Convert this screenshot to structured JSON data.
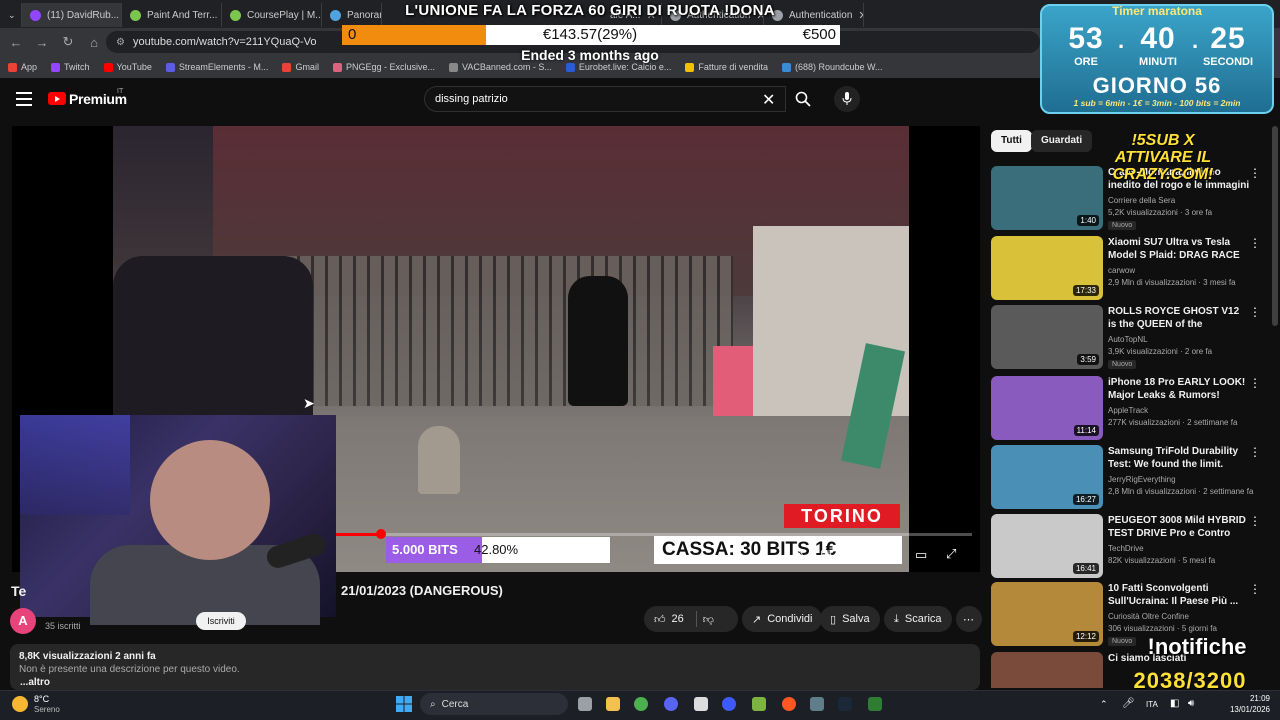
{
  "browser": {
    "tabs": [
      {
        "label": "(11) DavidRub..."
      },
      {
        "label": "Paint And Terr..."
      },
      {
        "label": "CoursePlay | M..."
      },
      {
        "label": "Panoramica"
      },
      {
        "label": "a Ri..."
      },
      {
        "label": "ntelli..."
      },
      {
        "label": "ale A..."
      },
      {
        "label": "Authentication"
      },
      {
        "label": "Authentication"
      }
    ],
    "url": "youtube.com/watch?v=211YQuaQ-Vo",
    "bookmarks": [
      "App",
      "Twitch",
      "YouTube",
      "StreamElements - M...",
      "Gmail",
      "PNGEgg - Exclusive...",
      "VACBanned.com - S...",
      "Eurobet.live: Calcio e...",
      "Fatture di vendita",
      "(688) Roundcube W..."
    ]
  },
  "stream_overlay": {
    "title": "L'UNIONE FA LA FORZA 60 GIRI DI RUOTA !DONA",
    "goal_start": "0",
    "goal_current": "€143.57(29%)",
    "goal_target": "€500",
    "goal_progress": 0.29,
    "ended_text": "Ended 3 months ago"
  },
  "timer": {
    "title": "Timer maratona",
    "hours": "53",
    "minutes": "40",
    "seconds": "25",
    "hours_label": "ORE",
    "minutes_label": "MINUTI",
    "seconds_label": "SECONDI",
    "day": "GIORNO 56",
    "rates": "1 sub = 6min - 1€ = 3min - 100 bits = 2min"
  },
  "promo": {
    "sub_line1": "!5SUB X",
    "sub_line2": "ATTIVARE IL",
    "sub_line3": "CRAZY.COM!",
    "notifiche": "!notifiche",
    "notifiche_count": "2038/3200"
  },
  "youtube": {
    "logo_text": "Premium",
    "region": "IT",
    "search_value": "dissing patrizio",
    "video": {
      "overlay_location": "TORINO",
      "bits_label": "5.000 BITS",
      "bits_pct": "42.80%",
      "bits_progress": 0.428,
      "cassa": "CASSA: 30 BITS 1€",
      "playback_progress": 0.07
    },
    "title_prefix": "Te",
    "title": "21/01/2023 (DANGEROUS)",
    "channel_initial": "A",
    "subscribers": "35 iscritti",
    "subscribe_label": "Iscriviti",
    "likes": "26",
    "share_label": "Condividi",
    "save_label": "Salva",
    "download_label": "Scarica",
    "description": {
      "views_date": "8,8K visualizzazioni  2 anni fa",
      "text": "Non è presente una descrizione per questo video.",
      "more": "...altro"
    },
    "chips": [
      "Tutti",
      "Guardati"
    ],
    "recommendations": [
      {
        "title": "Crans-Montana, il video inedito del rogo e le immagini del sottotetto",
        "channel": "Corriere della Sera",
        "meta": "5,2K visualizzazioni · 3 ore fa",
        "badge": "Nuovo",
        "duration": "1:40",
        "color": "#3a6e7a"
      },
      {
        "title": "Xiaomi SU7 Ultra vs Tesla Model S Plaid: DRAG RACE",
        "channel": "carwow",
        "meta": "2,9 Mln di visualizzazioni · 3 mesi fa",
        "badge": "",
        "duration": "17:33",
        "color": "#d9c23a"
      },
      {
        "title": "ROLLS ROYCE GHOST V12 is the QUEEN of the AUTOBAHN!",
        "channel": "AutoTopNL",
        "meta": "3,9K visualizzazioni · 2 ore fa",
        "badge": "Nuovo",
        "duration": "3:59",
        "color": "#5a5a5a"
      },
      {
        "title": "iPhone 18 Pro EARLY LOOK! Major Leaks & Rumors!",
        "channel": "AppleTrack",
        "meta": "277K visualizzazioni · 2 settimane fa",
        "badge": "",
        "duration": "11:14",
        "color": "#8a5bbf"
      },
      {
        "title": "Samsung TriFold Durability Test: We found the limit.",
        "channel": "JerryRigEverything",
        "meta": "2,8 Mln di visualizzazioni · 2 settimane fa",
        "badge": "",
        "duration": "16:27",
        "color": "#4a8fb5"
      },
      {
        "title": "PEUGEOT 3008 Mild HYBRID TEST DRIVE Pro e Contro",
        "channel": "TechDrive",
        "meta": "82K visualizzazioni · 5 mesi fa",
        "badge": "",
        "duration": "16:41",
        "color": "#c9c9c9"
      },
      {
        "title": "10 Fatti Sconvolgenti Sull'Ucraina: Il Paese Più ...",
        "channel": "Curiosità Oltre Confine",
        "meta": "306 visualizzazioni · 5 giorni fa",
        "badge": "Nuovo",
        "duration": "12:12",
        "color": "#b5893a"
      },
      {
        "title": "Ci siamo lasciati",
        "channel": "",
        "meta": "",
        "badge": "",
        "duration": "",
        "color": "#7a4a3a"
      }
    ]
  },
  "taskbar": {
    "temperature": "8°C",
    "weather": "Sereno",
    "search_label": "Cerca",
    "language": "ITA",
    "time": "21:09",
    "date": "13/01/2026"
  }
}
